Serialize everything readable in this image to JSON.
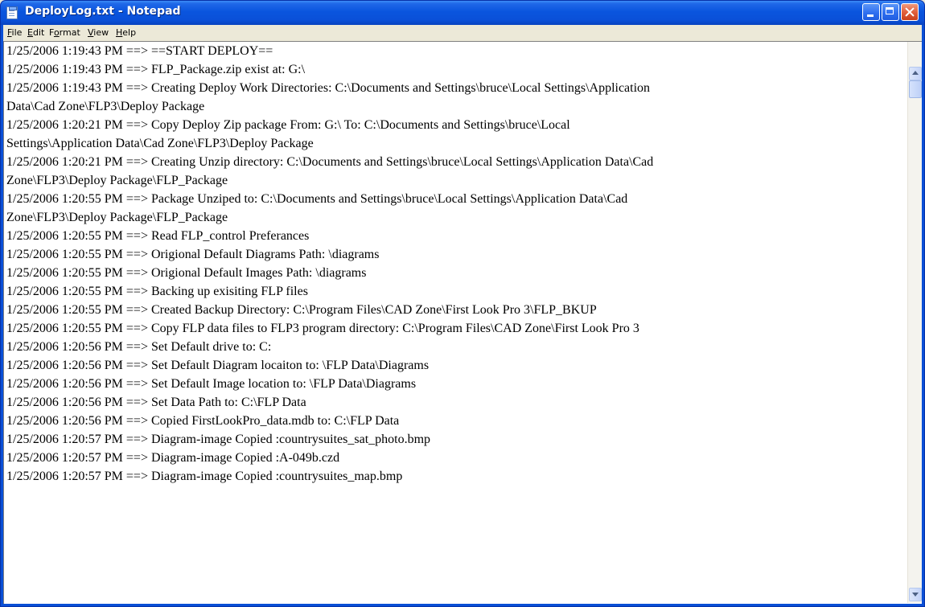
{
  "window": {
    "title": "DeployLog.txt - Notepad",
    "icon": "notepad-icon",
    "controls": [
      "minimize",
      "maximize",
      "close"
    ]
  },
  "menubar": {
    "file": {
      "accel": "F",
      "rest": "ile"
    },
    "edit": {
      "accel": "E",
      "rest": "dit"
    },
    "format": {
      "pre": "F",
      "accel": "o",
      "rest": "rmat"
    },
    "view": {
      "accel": "V",
      "rest": "iew"
    },
    "help": {
      "accel": "H",
      "rest": "elp"
    }
  },
  "lines": [
    "1/25/2006 1:19:43 PM ==> ==START DEPLOY==",
    "1/25/2006 1:19:43 PM ==> FLP_Package.zip exist at: G:\\",
    "1/25/2006 1:19:43 PM ==> Creating Deploy Work Directories: C:\\Documents and Settings\\bruce\\Local Settings\\Application",
    "Data\\Cad Zone\\FLP3\\Deploy Package",
    "1/25/2006 1:20:21 PM ==> Copy Deploy Zip package From: G:\\ To: C:\\Documents and Settings\\bruce\\Local",
    "Settings\\Application Data\\Cad Zone\\FLP3\\Deploy Package",
    "1/25/2006 1:20:21 PM ==> Creating Unzip directory: C:\\Documents and Settings\\bruce\\Local Settings\\Application Data\\Cad",
    "Zone\\FLP3\\Deploy Package\\FLP_Package",
    "1/25/2006 1:20:55 PM ==> Package Unziped to: C:\\Documents and Settings\\bruce\\Local Settings\\Application Data\\Cad",
    "Zone\\FLP3\\Deploy Package\\FLP_Package",
    "1/25/2006 1:20:55 PM ==> Read FLP_control Preferances",
    "1/25/2006 1:20:55 PM ==> Origional Default Diagrams Path: \\diagrams",
    "1/25/2006 1:20:55 PM ==> Origional Default Images Path: \\diagrams",
    "1/25/2006 1:20:55 PM ==> Backing up exisiting FLP files",
    "1/25/2006 1:20:55 PM ==> Created Backup Directory: C:\\Program Files\\CAD Zone\\First Look Pro 3\\FLP_BKUP",
    "1/25/2006 1:20:55 PM ==> Copy FLP data files to FLP3 program directory: C:\\Program Files\\CAD Zone\\First Look Pro 3",
    "1/25/2006 1:20:56 PM ==> Set Default drive to: C:",
    "1/25/2006 1:20:56 PM ==> Set Default Diagram locaiton to: \\FLP Data\\Diagrams",
    "1/25/2006 1:20:56 PM ==> Set Default Image location to: \\FLP Data\\Diagrams",
    "1/25/2006 1:20:56 PM ==> Set Data Path to: C:\\FLP Data",
    "1/25/2006 1:20:56 PM ==> Copied FirstLookPro_data.mdb to: C:\\FLP Data",
    "1/25/2006 1:20:57 PM ==> Diagram-image Copied :countrysuites_sat_photo.bmp",
    "1/25/2006 1:20:57 PM ==> Diagram-image Copied :A-049b.czd",
    "1/25/2006 1:20:57 PM ==> Diagram-image Copied :countrysuites_map.bmp"
  ]
}
